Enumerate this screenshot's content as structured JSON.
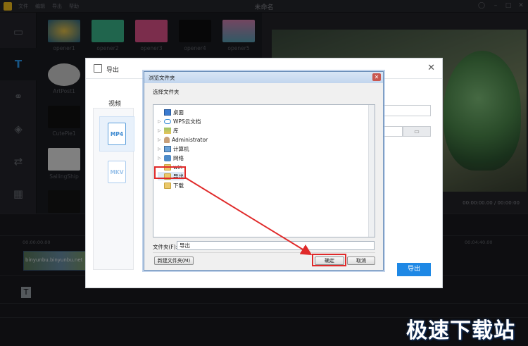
{
  "app": {
    "window_title": "未命名",
    "menu": [
      "文件",
      "编辑",
      "导出",
      "帮助"
    ]
  },
  "sidebar": {
    "items": [
      {
        "icon": "media-icon"
      },
      {
        "icon": "text-icon",
        "active": true
      },
      {
        "icon": "filter-icon"
      },
      {
        "icon": "overlay-icon"
      },
      {
        "icon": "transition-icon"
      },
      {
        "icon": "element-icon"
      }
    ]
  },
  "media": {
    "row1": [
      "opener1",
      "opener2",
      "opener3",
      "opener4",
      "opener5"
    ],
    "col": [
      "ArtPost1",
      "CutePie1",
      "SailingShip",
      ""
    ]
  },
  "preview": {
    "time": "00:00:00.00 / 00:00:00"
  },
  "timeline": {
    "clip_label": "binyunbu.binyunbu.net",
    "text_item": "T",
    "ruler_start": "00:00:00.00",
    "ruler_mid": "00:04:40.00"
  },
  "export_dialog": {
    "title": "导出",
    "tab": "视频",
    "formats": [
      "MP4",
      "MKV"
    ],
    "export_button": "导出"
  },
  "browse_dialog": {
    "title": "浏览文件夹",
    "instruction": "选择文件夹",
    "tree": [
      {
        "label": "桌面",
        "icon": "desktop-icon",
        "expand": ""
      },
      {
        "label": "WPS云文档",
        "icon": "cloud-icon",
        "expand": "▷"
      },
      {
        "label": "库",
        "icon": "library-icon",
        "expand": "▷"
      },
      {
        "label": "Administrator",
        "icon": "user-icon",
        "expand": "▷"
      },
      {
        "label": "计算机",
        "icon": "computer-icon",
        "expand": "▷"
      },
      {
        "label": "网络",
        "icon": "network-icon",
        "expand": "▷"
      },
      {
        "label": "win",
        "icon": "folder-icon",
        "expand": ""
      },
      {
        "label": "导出",
        "icon": "folder-icon",
        "expand": "",
        "selected": true
      },
      {
        "label": "下载",
        "icon": "folder-icon",
        "expand": ""
      }
    ],
    "folder_label": "文件夹(F):",
    "folder_value": "导出",
    "new_folder_button": "新建文件夹(M)",
    "ok_button": "确定",
    "cancel_button": "取消",
    "close_glyph": "✕"
  },
  "watermark": "极速下载站",
  "colors": {
    "accent": "#1e88e5",
    "highlight": "#e02a2a"
  }
}
